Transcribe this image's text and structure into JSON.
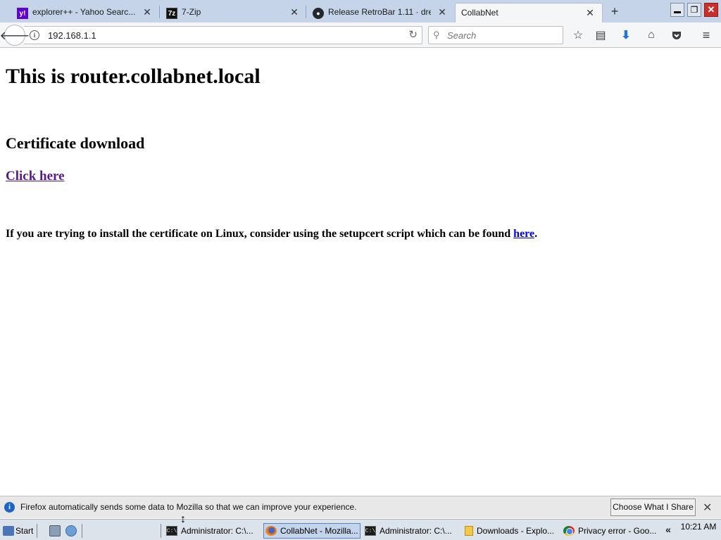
{
  "tabs": [
    {
      "title": "explorer++ - Yahoo Searc...",
      "icon": "yahoo-icon",
      "active": false
    },
    {
      "title": "7-Zip",
      "icon": "7zip-icon",
      "active": false
    },
    {
      "title": "Release RetroBar 1.11 · dre...",
      "icon": "github-icon",
      "active": false
    },
    {
      "title": "CollabNet",
      "icon": "",
      "active": true
    }
  ],
  "new_tab_glyph": "+",
  "window_controls": {
    "minimize": "▁",
    "restore": "❐",
    "close": "✕"
  },
  "navbar": {
    "url": "192.168.1.1",
    "search_placeholder": "Search"
  },
  "page": {
    "heading": "This is router.collabnet.local",
    "subheading": "Certificate download",
    "download_link": "Click here",
    "note_text": "If you are trying to install the certificate on Linux, consider using the setupcert script which can be found",
    "note_link": "here",
    "note_end": "."
  },
  "notification": {
    "message": "Firefox automatically sends some data to Mozilla so that we can improve your experience.",
    "button": "Choose What I Share"
  },
  "taskbar": {
    "start_label": "Start",
    "tasks": [
      {
        "label": "Administrator: C:\\...",
        "icon": "cmd-icon",
        "active": false
      },
      {
        "label": "CollabNet - Mozilla...",
        "icon": "firefox-icon",
        "active": true
      },
      {
        "label": "Administrator: C:\\...",
        "icon": "cmd-icon",
        "active": false
      },
      {
        "label": "Downloads - Explo...",
        "icon": "folder-icon",
        "active": false
      },
      {
        "label": "Privacy error - Goo...",
        "icon": "chrome-icon",
        "active": false
      }
    ],
    "tray_chevron": "«",
    "clock": "10:21 AM"
  },
  "colors": {
    "tabstrip": "#c5d4e8",
    "visited_link": "#551a8b",
    "link": "#0000ee",
    "info_blue": "#1c64c8"
  }
}
